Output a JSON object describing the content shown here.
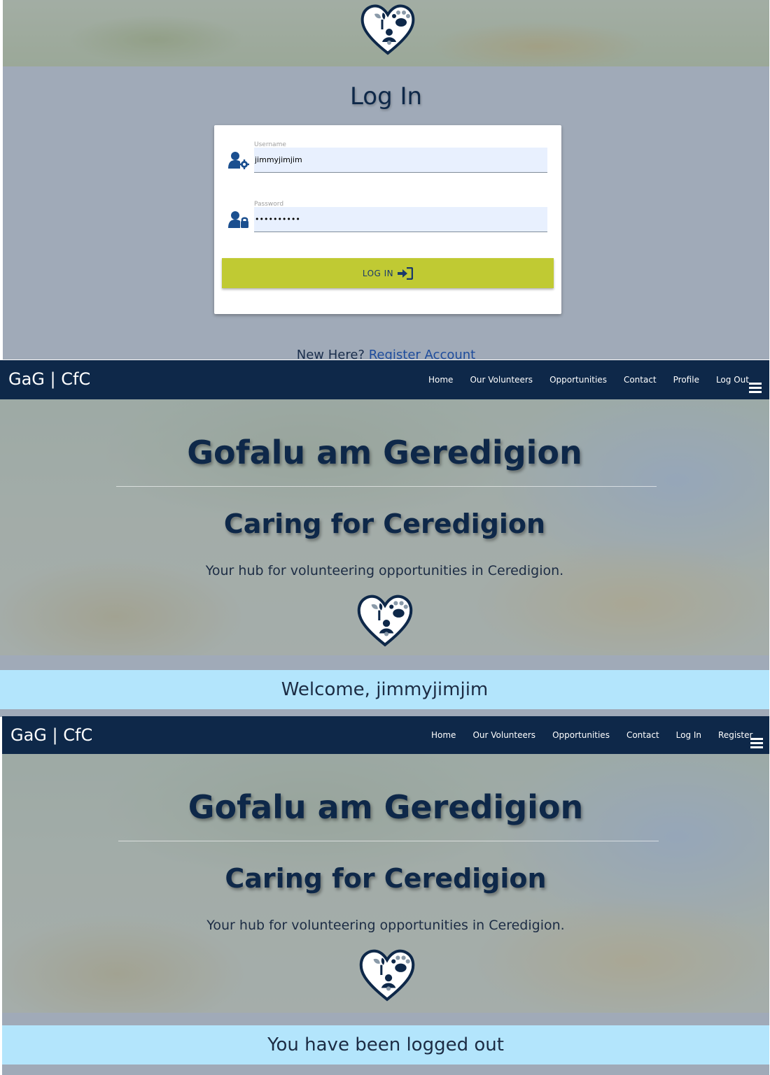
{
  "login_screen": {
    "title": "Log In",
    "username": {
      "label": "Username",
      "value": "jimmyjimjim",
      "icon": "user-gear-icon"
    },
    "password": {
      "label": "Password",
      "value": "••••••••••",
      "icon": "user-lock-icon"
    },
    "login_button": {
      "label": "LOG IN",
      "icon": "sign-in-icon"
    },
    "register_prompt": "New Here?",
    "register_link": "Register Account",
    "button_color": "#c0ca33"
  },
  "logged_in_screen": {
    "brand": "GaG | CfC",
    "nav": [
      "Home",
      "Our Volunteers",
      "Opportunities",
      "Contact",
      "Profile",
      "Log Out"
    ],
    "heading": "Gofalu am Geredigion",
    "subheading": "Caring for Ceredigion",
    "tagline": "Your hub for volunteering opportunities in Ceredigion.",
    "alert": "Welcome, jimmyjimjim"
  },
  "logged_out_screen": {
    "brand": "GaG | CfC",
    "nav": [
      "Home",
      "Our Volunteers",
      "Opportunities",
      "Contact",
      "Log In",
      "Register"
    ],
    "heading": "Gofalu am Geredigion",
    "subheading": "Caring for Ceredigion",
    "tagline": "Your hub for volunteering opportunities in Ceredigion.",
    "alert": "You have been logged out"
  },
  "colors": {
    "navbar": "#0e2849",
    "alert_background": "#b3e5fc",
    "page_background": "#a0aab8",
    "input_background": "#e8f0fe"
  },
  "logo_icon": "heart-logo-icon",
  "menu_icon": "hamburger-menu-icon"
}
